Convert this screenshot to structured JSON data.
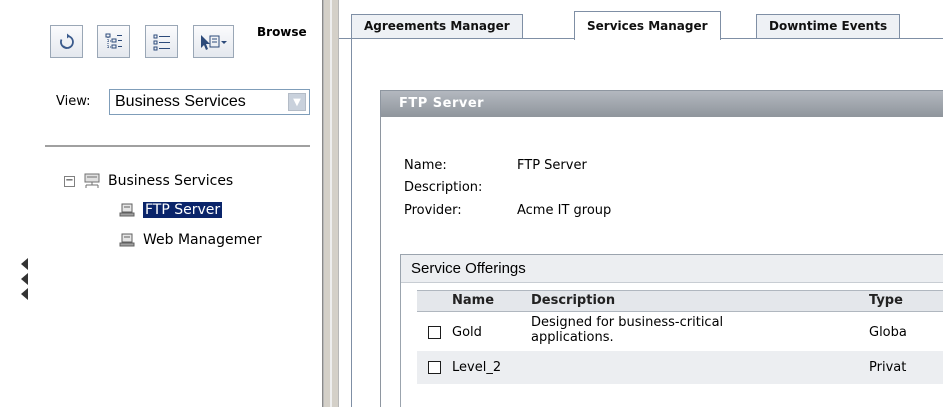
{
  "left_pane": {
    "browse_label": "Browse",
    "toolbar": {
      "refresh_icon": "refresh-icon",
      "hierarchy_icon": "tree-view-icon",
      "list_icon": "list-view-icon",
      "menu_icon": "new-item-dropdown-icon"
    },
    "view_label": "View:",
    "view_value": "Business Services",
    "tree": {
      "root_expander": "−",
      "root_label": "Business Services",
      "children": [
        {
          "label": "FTP Server",
          "selected": true
        },
        {
          "label": "Web Managemer",
          "selected": false
        }
      ]
    }
  },
  "tabs": [
    "Agreements Manager",
    "Services Manager",
    "Downtime Events"
  ],
  "active_tab": "Services Manager",
  "panel": {
    "title": "FTP Server",
    "name_label": "Name:",
    "name_value": "FTP Server",
    "description_label": "Description:",
    "description_value": "",
    "provider_label": "Provider:",
    "provider_value": "Acme IT group"
  },
  "offerings": {
    "title": "Service Offerings",
    "columns": [
      "Name",
      "Description",
      "Type"
    ],
    "rows": [
      {
        "name": "Gold",
        "description_line1": "Designed for business-critical",
        "description_line2": "applications.",
        "type": "Globa"
      },
      {
        "name": "Level_2",
        "description_line1": "",
        "description_line2": "",
        "type": "Privat"
      }
    ]
  },
  "colors": {
    "selection": "#0a246a",
    "panel_header": "#9da2a9",
    "tab_border": "#7f8fa5"
  }
}
